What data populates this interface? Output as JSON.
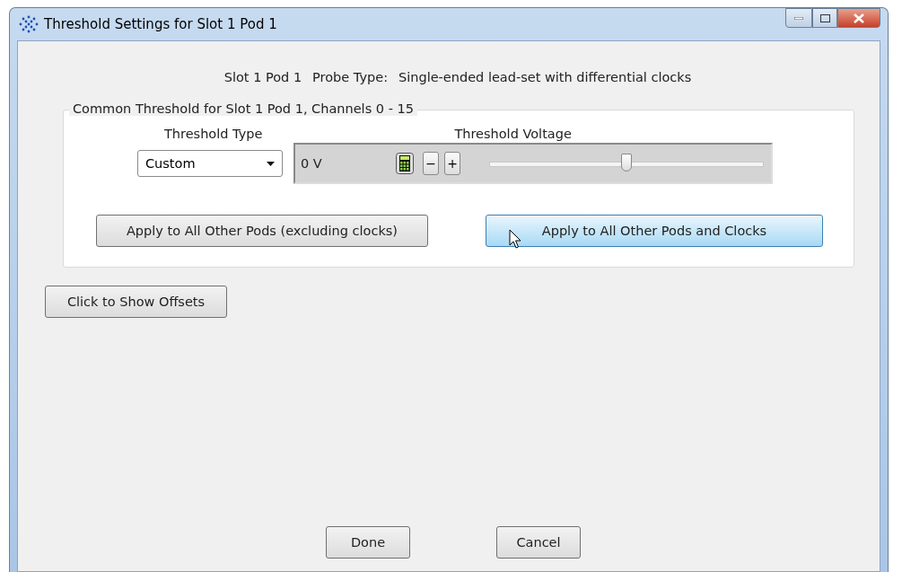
{
  "window": {
    "title": "Threshold Settings for Slot 1 Pod 1"
  },
  "header": {
    "slot": "Slot 1 Pod 1",
    "probe_label": "Probe Type:",
    "probe_value": "Single-ended lead-set with differential clocks"
  },
  "group": {
    "title": "Common Threshold for Slot 1 Pod 1, Channels 0 - 15",
    "threshold_type": {
      "label": "Threshold Type",
      "value": "Custom"
    },
    "threshold_voltage": {
      "label": "Threshold Voltage",
      "value": "0 V",
      "minus": "−",
      "plus": "+",
      "level": 0.5
    },
    "buttons": [
      {
        "label": "Apply to All Other Pods (excluding clocks)",
        "hovered": false
      },
      {
        "label": "Apply to All Other Pods and Clocks",
        "hovered": true
      }
    ]
  },
  "offsets_button": "Click to Show Offsets",
  "footer_buttons": [
    "Done",
    "Cancel"
  ]
}
